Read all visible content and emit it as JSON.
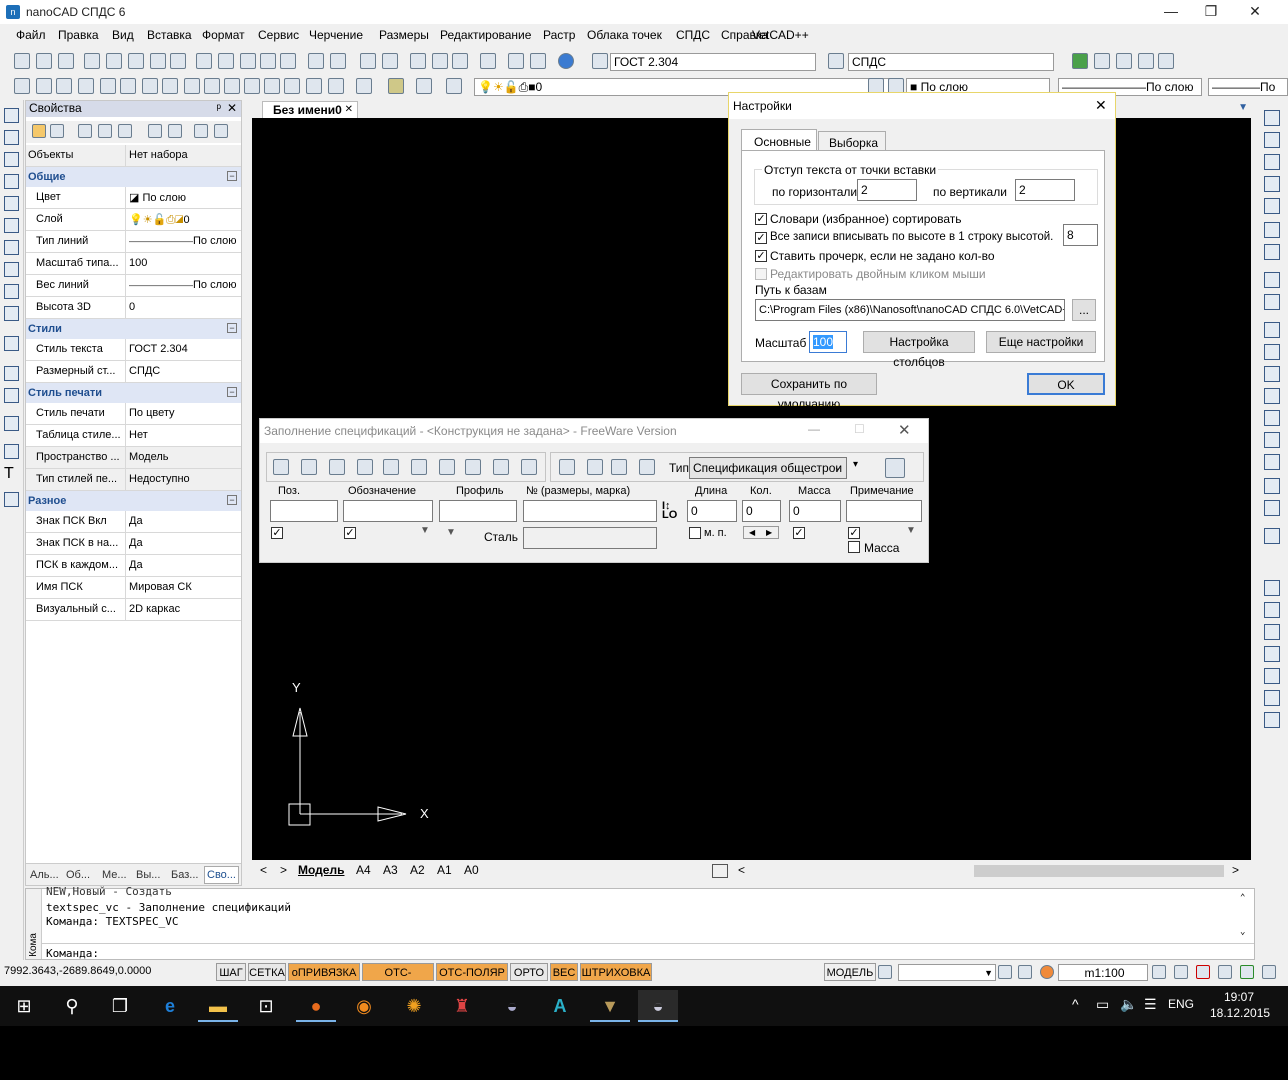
{
  "window": {
    "title": "nanoCAD СПДС 6",
    "min": "—",
    "max": "❐",
    "close": "✕"
  },
  "menu": [
    "Файл",
    "Правка",
    "Вид",
    "Вставка",
    "Формат",
    "Сервис",
    "Черчение",
    "Размеры",
    "Редактирование",
    "Растр",
    "Облака точек",
    "СПДС",
    "Справка",
    "VetCAD++"
  ],
  "toolbar": {
    "text_style": "ГОСТ 2.304",
    "dim_style": "СПДС",
    "layer": "0",
    "color": "По слою",
    "linetype": "По слою",
    "lineweight": "По"
  },
  "properties": {
    "title": "Свойства",
    "pin": "ᵖ",
    "close": "✕",
    "objects_label": "Объекты",
    "objects_value": "Нет набора",
    "sections": [
      {
        "name": "Общие",
        "rows": [
          {
            "k": "Цвет",
            "v": "По слою"
          },
          {
            "k": "Слой",
            "v": "0"
          },
          {
            "k": "Тип линий",
            "v": "По слою"
          },
          {
            "k": "Масштаб типа...",
            "v": "100"
          },
          {
            "k": "Вес линий",
            "v": "По слою"
          },
          {
            "k": "Высота 3D",
            "v": "0"
          }
        ]
      },
      {
        "name": "Стили",
        "rows": [
          {
            "k": "Стиль текста",
            "v": "ГОСТ 2.304"
          },
          {
            "k": "Размерный ст...",
            "v": "СПДС"
          }
        ]
      },
      {
        "name": "Стиль печати",
        "rows": [
          {
            "k": "Стиль печати",
            "v": "По цвету"
          },
          {
            "k": "Таблица стиле...",
            "v": "Нет"
          },
          {
            "k": "Пространство ...",
            "v": "Модель"
          },
          {
            "k": "Тип стилей пе...",
            "v": "Недоступно"
          }
        ]
      },
      {
        "name": "Разное",
        "rows": [
          {
            "k": "Знак ПСК Вкл",
            "v": "Да"
          },
          {
            "k": "Знак ПСК в на...",
            "v": "Да"
          },
          {
            "k": "ПСК в каждом...",
            "v": "Да"
          },
          {
            "k": "Имя ПСК",
            "v": "Мировая СК"
          },
          {
            "k": "Визуальный с...",
            "v": "2D каркас"
          }
        ]
      }
    ],
    "collapse": "−",
    "tabs": [
      "Аль...",
      "Об...",
      "Ме...",
      "Вы...",
      "Баз...",
      "Сво..."
    ]
  },
  "doc_tab": {
    "name": "Без имени0",
    "close": "✕"
  },
  "ucs": {
    "x": "X",
    "y": "Y"
  },
  "layout_tabs": [
    "Модель",
    "A4",
    "A3",
    "A2",
    "A1",
    "A0"
  ],
  "command": {
    "lines": [
      "NEW,Новый - Создать",
      "textspec_vc - Заполнение спецификаций",
      "Команда: TEXTSPEC_VC"
    ],
    "prompt": "Команда:",
    "side_label": "Кома"
  },
  "status": {
    "coords": "7992.3643,-2689.8649,0.0000",
    "buttons": [
      {
        "label": "ШАГ",
        "on": false
      },
      {
        "label": "СЕТКА",
        "on": false
      },
      {
        "label": "оПРИВЯЗКА",
        "on": true
      },
      {
        "label": "ОТС-ОБЪЕКТ",
        "on": true
      },
      {
        "label": "ОТС-ПОЛЯР",
        "on": true
      },
      {
        "label": "ОРТО",
        "on": false
      },
      {
        "label": "ВЕС",
        "on": true
      },
      {
        "label": "ШТРИХОВКА",
        "on": true
      }
    ],
    "space": "МОДЕЛЬ",
    "scale": "m1:100"
  },
  "settings_dialog": {
    "title": "Настройки",
    "tabs": [
      "Основные",
      "Выборка"
    ],
    "group_title": "Отступ текста от точки вставки",
    "horiz_label": "по горизонтали",
    "horiz_value": "2",
    "vert_label": "по вертикали",
    "vert_value": "2",
    "checks": [
      {
        "label": "Словари (избранное) сортировать",
        "checked": true,
        "disabled": false
      },
      {
        "label": "Все записи вписывать по высоте в 1 строку высотой.",
        "checked": true,
        "disabled": false
      },
      {
        "label": "Ставить прочерк, если не задано кол-во",
        "checked": true,
        "disabled": false
      },
      {
        "label": "Редактировать двойным кликом мыши",
        "checked": false,
        "disabled": true
      }
    ],
    "row_height_value": "8",
    "path_label": "Путь к базам",
    "path_value": "C:\\Program Files (x86)\\Nanosoft\\nanoCAD СПДС 6.0\\VetCAD+",
    "browse": "...",
    "scale_label": "Масштаб",
    "scale_value": "100",
    "columns_button": "Настройка столбцов",
    "more_button": "Еще настройки",
    "save_default": "Сохранить по умолчанию",
    "ok": "OK",
    "close": "✕"
  },
  "spec_dialog": {
    "title": "Заполнение спецификаций - <Конструкция не задана> - FreeWare Version",
    "min": "—",
    "max": "☐",
    "close": "✕",
    "type_label": "Тип",
    "type_value": "Спецификация общестрои",
    "columns": {
      "pos": "Поз.",
      "designation": "Обозначение",
      "profile": "Профиль",
      "number": "№ (размеры, марка)",
      "length": "Длина",
      "qty": "Кол.",
      "mass": "Масса",
      "note": "Примечание"
    },
    "length_value": "0",
    "qty_value": "0",
    "mass_value": "0",
    "steel_label": "Сталь",
    "mp_label": "м. п.",
    "mass_check_label": "Масса"
  },
  "taskbar": {
    "time": "19:07",
    "date": "18.12.2015",
    "lang": "ENG"
  }
}
